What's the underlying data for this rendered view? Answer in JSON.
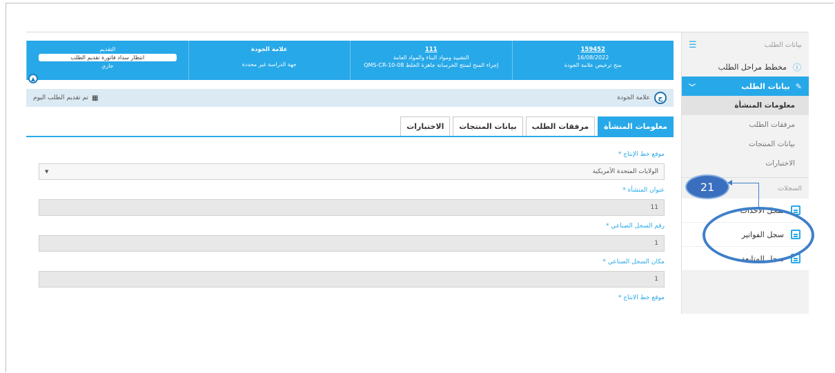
{
  "sidebar": {
    "header": "بيانات الطلب",
    "items": [
      {
        "label": "مخطط مراحل الطلب"
      }
    ],
    "active": {
      "label": "بيانات الطلب"
    },
    "sub_items": [
      {
        "label": "معلومات المنشأة",
        "selected": true
      },
      {
        "label": "مرفقات الطلب"
      },
      {
        "label": "بيانات المنتجات"
      },
      {
        "label": "الاختبارات"
      }
    ],
    "section_title": "السجلات",
    "logs": [
      {
        "label": "سجل الاحداث"
      },
      {
        "label": "سجل الفواتير"
      },
      {
        "label": "سجل المتابعة"
      }
    ]
  },
  "banner": {
    "col1": {
      "top": "159452",
      "mid": "16/08/2022",
      "bottom": "منح ترخيص علامة الجودة"
    },
    "col2": {
      "top": "111",
      "mid": "التشييد ومواد البناء والمواد العامة",
      "bottom": "QMS-CR-10-08 إجراء المنح لمنتج الخرسانة جاهزة الخلط"
    },
    "col3": {
      "top": "علامة الجودة",
      "bottom": "جهة الدراسة غير محددة"
    },
    "col4": {
      "top": "التقديم",
      "box": "انتظار سداد فاتورة تقديم الطلب",
      "bottom": "جاري"
    }
  },
  "infobar": {
    "badge": "ج",
    "right_label": "علامة الجودة",
    "left_label": "تم تقديم الطلب اليوم"
  },
  "tabs": [
    {
      "label": "معلومات المنشأة",
      "active": true
    },
    {
      "label": "مرفقات الطلب"
    },
    {
      "label": "بيانات المنتجات"
    },
    {
      "label": "الاختبارات"
    }
  ],
  "form": {
    "fields": [
      {
        "label": "موقع خط الإنتاج",
        "value": "الولايات المتحدة الأمريكية",
        "type": "select"
      },
      {
        "label": "عنوان المنشأة",
        "value": "11"
      },
      {
        "label": "رقم السجل الصناعي",
        "value": "1"
      },
      {
        "label": "مكان السجل الصناعي",
        "value": "1"
      },
      {
        "label": "موقع خط الانتاج",
        "value": ""
      }
    ]
  },
  "annotation": {
    "number": "21"
  },
  "colors": {
    "accent": "#27a8e8",
    "annotation": "#3a6fbf"
  }
}
